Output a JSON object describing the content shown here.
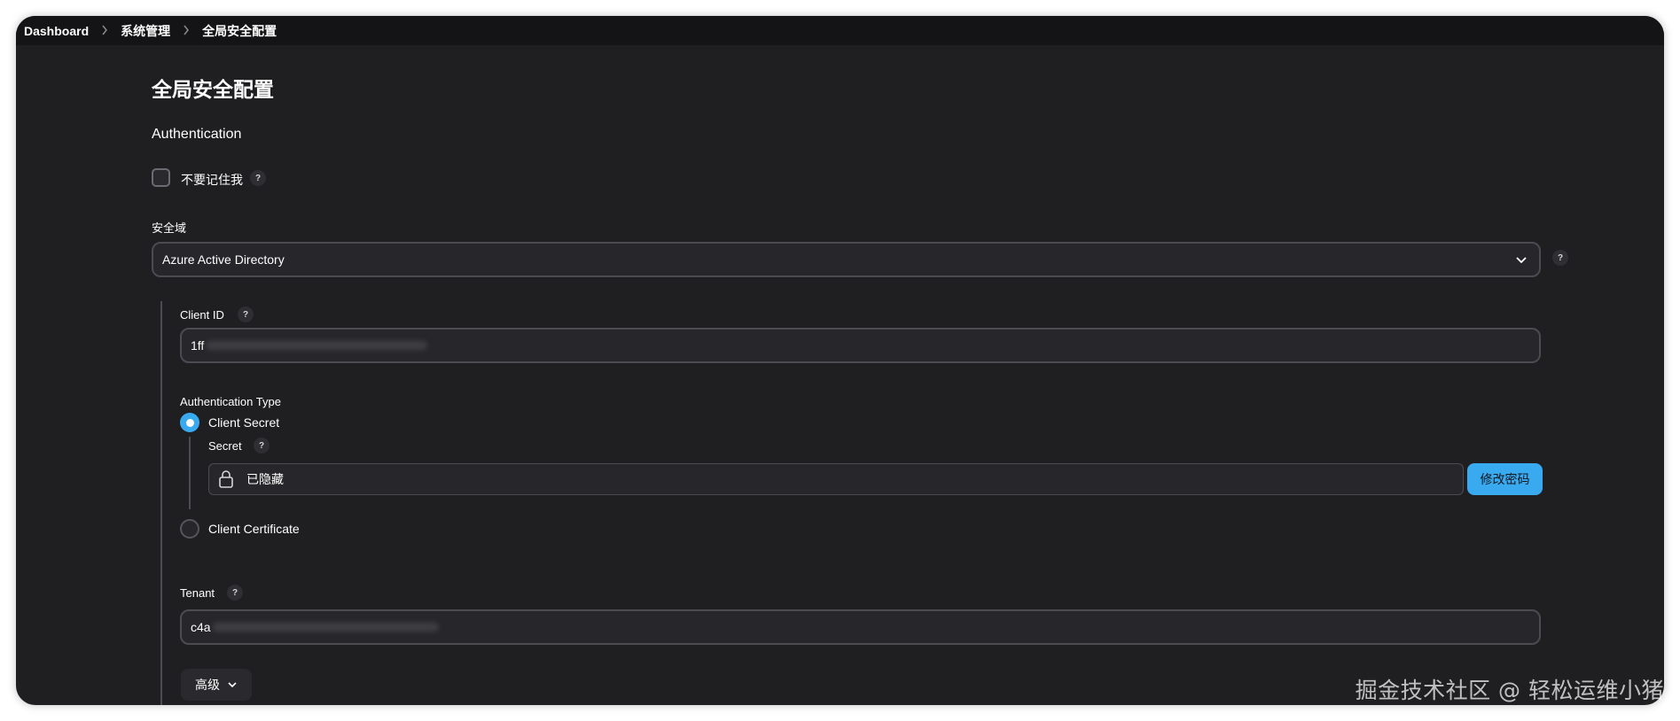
{
  "breadcrumb": {
    "items": [
      "Dashboard",
      "系统管理",
      "全局安全配置"
    ]
  },
  "page_title": "全局安全配置",
  "authentication": {
    "section_title": "Authentication",
    "remember_me_label": "不要记住我",
    "remember_me_checked": false,
    "help_glyph": "?"
  },
  "security_realm": {
    "label": "安全域",
    "selected": "Azure Active Directory",
    "client_id": {
      "label": "Client ID",
      "value_prefix": "1ff"
    },
    "auth_type": {
      "label": "Authentication Type",
      "options": [
        "Client Secret",
        "Client Certificate"
      ],
      "selected": "Client Secret"
    },
    "secret": {
      "label": "Secret",
      "value": "已隐藏",
      "change_button": "修改密码"
    },
    "tenant": {
      "label": "Tenant",
      "value_prefix": "c4a"
    },
    "advanced_button": "高级"
  },
  "watermark": "掘金技术社区 @ 轻松运维小猪",
  "colors": {
    "background": "#1f1f22",
    "breadcrumb_bar": "#141416",
    "accent": "#3aaaf0",
    "border": "#4b4b52"
  },
  "icons": {
    "breadcrumb_separator": "chevron-right-icon",
    "select_arrow": "chevron-down-icon",
    "secret_lock": "lock-icon",
    "advanced_arrow": "chevron-down-icon"
  }
}
